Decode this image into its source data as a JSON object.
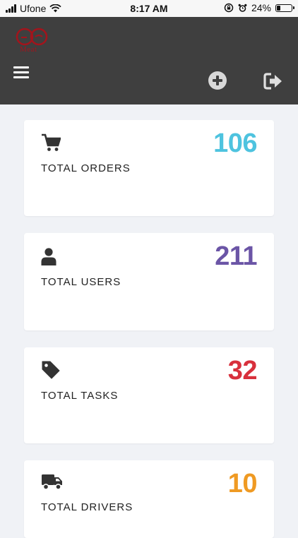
{
  "status_bar": {
    "carrier": "Ufone",
    "time": "8:17 AM",
    "battery": "24%",
    "battery_level": 0.24
  },
  "header": {
    "logo_text": "Meat",
    "icons": [
      "menu-icon",
      "add-icon",
      "logout-icon"
    ]
  },
  "stats": [
    {
      "label": "TOTAL ORDERS",
      "value": "106",
      "icon": "cart-icon",
      "color": "#4ec3df"
    },
    {
      "label": "TOTAL USERS",
      "value": "211",
      "icon": "user-icon",
      "color": "#6b55a6"
    },
    {
      "label": "TOTAL TASKS",
      "value": "32",
      "icon": "tag-icon",
      "color": "#d8303c"
    },
    {
      "label": "TOTAL DRIVERS",
      "value": "10",
      "icon": "truck-icon",
      "color": "#ef9a23"
    }
  ]
}
